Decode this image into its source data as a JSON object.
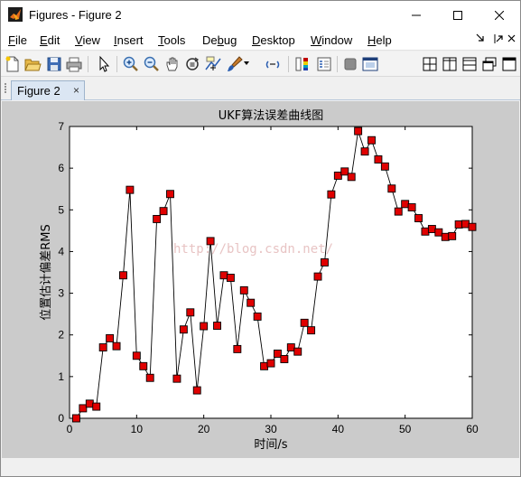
{
  "window": {
    "title": "Figures - Figure 2"
  },
  "menubar": {
    "items": [
      {
        "pre": "",
        "u": "F",
        "post": "ile"
      },
      {
        "pre": "",
        "u": "E",
        "post": "dit"
      },
      {
        "pre": "",
        "u": "V",
        "post": "iew"
      },
      {
        "pre": "",
        "u": "I",
        "post": "nsert"
      },
      {
        "pre": "",
        "u": "T",
        "post": "ools"
      },
      {
        "pre": "De",
        "u": "b",
        "post": "ug"
      },
      {
        "pre": "",
        "u": "D",
        "post": "esktop"
      },
      {
        "pre": "",
        "u": "W",
        "post": "indow"
      },
      {
        "pre": "",
        "u": "H",
        "post": "elp"
      }
    ]
  },
  "toolbar": {
    "icons": [
      "new-figure-icon",
      "open-file-icon",
      "save-icon",
      "print-icon",
      "edit-plot-arrow-icon",
      "zoom-in-icon",
      "zoom-out-icon",
      "pan-hand-icon",
      "rotate-3d-icon",
      "data-cursor-icon",
      "brush-icon",
      "link-plot-icon",
      "insert-colorbar-icon",
      "insert-legend-icon",
      "hide-plot-tools-icon",
      "show-plot-tools-icon"
    ],
    "layout_icons": [
      "tile-grid-icon",
      "left-right-split-icon",
      "top-bottom-split-icon",
      "float-window-icon"
    ]
  },
  "tabs": {
    "active_label": "Figure 2",
    "close_glyph": "×"
  },
  "colors": {
    "marker_fill": "#e00000",
    "line": "#000000",
    "figure_bg": "#cbcbcb",
    "axes_bg": "#ffffff"
  },
  "watermark": "http://blog.csdn.net/",
  "chart_data": {
    "type": "line",
    "title": "UKF算法误差曲线图",
    "xlabel": "时间/s",
    "ylabel": "位置估计偏差RMS",
    "xlim": [
      0,
      60
    ],
    "ylim": [
      0,
      7
    ],
    "xticks": [
      0,
      10,
      20,
      30,
      40,
      50,
      60
    ],
    "yticks": [
      0,
      1,
      2,
      3,
      4,
      5,
      6,
      7
    ],
    "marker": "square",
    "series": [
      {
        "x": [
          1,
          2,
          3,
          4,
          5,
          6,
          7,
          8,
          9,
          10,
          11,
          12,
          13,
          14,
          15,
          16,
          17,
          18,
          19,
          20,
          21,
          22,
          23,
          24,
          25,
          26,
          27,
          28,
          29,
          30,
          31,
          32,
          33,
          34,
          35,
          36,
          37,
          38,
          39,
          40,
          41,
          42,
          43,
          44,
          45,
          46,
          47,
          48,
          49,
          50,
          51,
          52,
          53,
          54,
          55,
          56,
          57,
          58,
          59,
          60
        ],
        "values": [
          0.0,
          0.24,
          0.35,
          0.28,
          1.7,
          1.92,
          1.73,
          3.43,
          5.48,
          1.5,
          1.25,
          0.97,
          4.78,
          4.97,
          5.38,
          0.95,
          2.13,
          2.54,
          0.67,
          2.21,
          4.25,
          2.22,
          3.43,
          3.37,
          1.66,
          3.07,
          2.77,
          2.44,
          1.25,
          1.32,
          1.55,
          1.42,
          1.7,
          1.6,
          2.29,
          2.11,
          3.4,
          3.74,
          5.37,
          5.82,
          5.92,
          5.79,
          6.89,
          6.4,
          6.67,
          6.21,
          6.04,
          5.51,
          4.96,
          5.14,
          5.06,
          4.8,
          4.48,
          4.54,
          4.46,
          4.35,
          4.37,
          4.65,
          4.66,
          4.59
        ]
      }
    ]
  }
}
